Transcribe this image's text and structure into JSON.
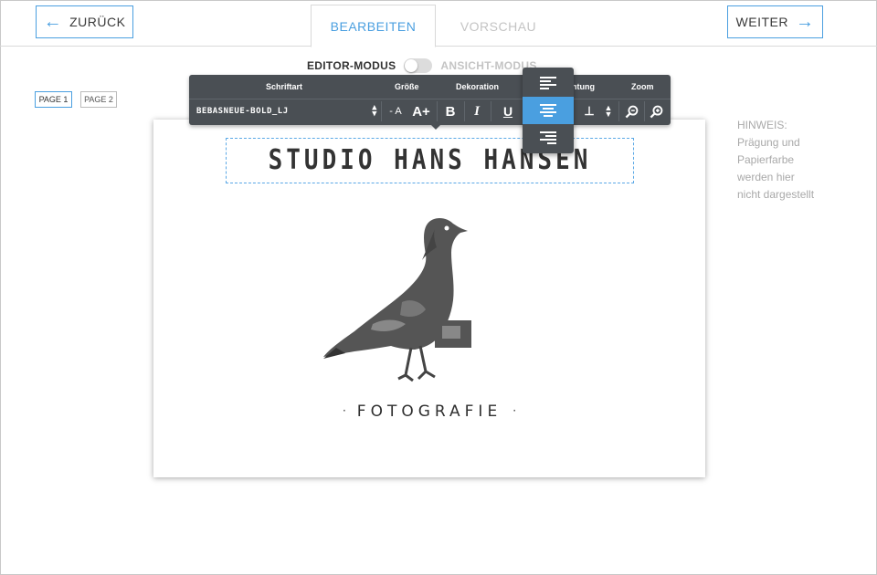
{
  "nav": {
    "back_label": "ZURÜCK",
    "next_label": "WEITER"
  },
  "tabs": [
    {
      "label": "BEARBEITEN",
      "active": true
    },
    {
      "label": "VORSCHAU",
      "active": false
    }
  ],
  "mode": {
    "editor_label": "EDITOR-MODUS",
    "view_label": "ANSICHT-MODUS"
  },
  "pages": [
    {
      "label": "PAGE 1",
      "active": true
    },
    {
      "label": "PAGE 2",
      "active": false
    }
  ],
  "toolbar": {
    "headers": {
      "font": "Schriftart",
      "size": "Größe",
      "decoration": "Dekoration",
      "alignment": "htung",
      "zoom": "Zoom"
    },
    "font_value": "BEBASNEUE-BOLD_LJ",
    "size_decrease": "- A",
    "size_increase": "A+",
    "bold": "B",
    "italic": "I",
    "underline": "U",
    "align_options": [
      "left",
      "center",
      "right"
    ],
    "align_selected": "center"
  },
  "card": {
    "title": "STUDIO HANS HANSEN",
    "subtitle": "FOTOGRAFIE"
  },
  "hint": {
    "title": "HINWEIS:",
    "lines": [
      "Prägung und",
      "Papierfarbe",
      "werden hier",
      "nicht dargestellt"
    ]
  },
  "colors": {
    "accent": "#4a9fe0",
    "toolbar_bg": "#4a4f54",
    "muted_text": "#c4c4c4"
  }
}
